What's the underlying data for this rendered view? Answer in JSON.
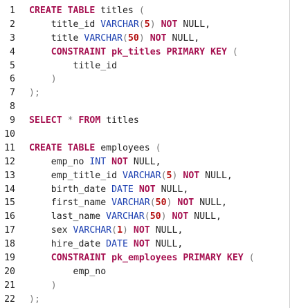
{
  "editor": {
    "colors": {
      "keyword": "#a50f4f",
      "type": "#1a3eb0",
      "number": "#b30c0c",
      "punctuation": "#7a7a7a",
      "identifier": "#1f1f1f",
      "line_number": "#222222"
    },
    "lines": [
      {
        "n": "1",
        "tokens": [
          [
            "kw",
            "CREATE TABLE"
          ],
          [
            "id",
            " titles "
          ],
          [
            "p",
            "("
          ]
        ]
      },
      {
        "n": "2",
        "tokens": [
          [
            "id",
            "    title_id "
          ],
          [
            "ty",
            "VARCHAR"
          ],
          [
            "p",
            "("
          ],
          [
            "num",
            "5"
          ],
          [
            "p",
            ")"
          ],
          [
            "id",
            " "
          ],
          [
            "kw",
            "NOT"
          ],
          [
            "id",
            " NULL,"
          ]
        ]
      },
      {
        "n": "3",
        "tokens": [
          [
            "id",
            "    title "
          ],
          [
            "ty",
            "VARCHAR"
          ],
          [
            "p",
            "("
          ],
          [
            "num",
            "50"
          ],
          [
            "p",
            ")"
          ],
          [
            "id",
            " "
          ],
          [
            "kw",
            "NOT"
          ],
          [
            "id",
            " NULL,"
          ]
        ]
      },
      {
        "n": "4",
        "tokens": [
          [
            "id",
            "    "
          ],
          [
            "kw",
            "CONSTRAINT"
          ],
          [
            "id",
            " "
          ],
          [
            "kw",
            "pk_titles"
          ],
          [
            "id",
            " "
          ],
          [
            "kw",
            "PRIMARY KEY"
          ],
          [
            "id",
            " "
          ],
          [
            "p",
            "("
          ]
        ]
      },
      {
        "n": "5",
        "tokens": [
          [
            "id",
            "        title_id"
          ]
        ]
      },
      {
        "n": "6",
        "tokens": [
          [
            "id",
            "    "
          ],
          [
            "p",
            ")"
          ]
        ]
      },
      {
        "n": "7",
        "tokens": [
          [
            "p",
            ");"
          ]
        ]
      },
      {
        "n": "8",
        "tokens": []
      },
      {
        "n": "9",
        "tokens": [
          [
            "kw",
            "SELECT"
          ],
          [
            "id",
            " "
          ],
          [
            "p",
            "*"
          ],
          [
            "id",
            " "
          ],
          [
            "kw",
            "FROM"
          ],
          [
            "id",
            " titles"
          ]
        ]
      },
      {
        "n": "10",
        "tokens": []
      },
      {
        "n": "11",
        "tokens": [
          [
            "kw",
            "CREATE TABLE"
          ],
          [
            "id",
            " employees "
          ],
          [
            "p",
            "("
          ]
        ]
      },
      {
        "n": "12",
        "tokens": [
          [
            "id",
            "    emp_no "
          ],
          [
            "ty",
            "INT"
          ],
          [
            "id",
            " "
          ],
          [
            "kw",
            "NOT"
          ],
          [
            "id",
            " NULL,"
          ]
        ]
      },
      {
        "n": "13",
        "tokens": [
          [
            "id",
            "    emp_title_id "
          ],
          [
            "ty",
            "VARCHAR"
          ],
          [
            "p",
            "("
          ],
          [
            "num",
            "5"
          ],
          [
            "p",
            ")"
          ],
          [
            "id",
            " "
          ],
          [
            "kw",
            "NOT"
          ],
          [
            "id",
            " NULL,"
          ]
        ]
      },
      {
        "n": "14",
        "tokens": [
          [
            "id",
            "    birth_date "
          ],
          [
            "ty",
            "DATE"
          ],
          [
            "id",
            " "
          ],
          [
            "kw",
            "NOT"
          ],
          [
            "id",
            " NULL,"
          ]
        ]
      },
      {
        "n": "15",
        "tokens": [
          [
            "id",
            "    first_name "
          ],
          [
            "ty",
            "VARCHAR"
          ],
          [
            "p",
            "("
          ],
          [
            "num",
            "50"
          ],
          [
            "p",
            ")"
          ],
          [
            "id",
            " "
          ],
          [
            "kw",
            "NOT"
          ],
          [
            "id",
            " NULL,"
          ]
        ]
      },
      {
        "n": "16",
        "tokens": [
          [
            "id",
            "    last_name "
          ],
          [
            "ty",
            "VARCHAR"
          ],
          [
            "p",
            "("
          ],
          [
            "num",
            "50"
          ],
          [
            "p",
            ")"
          ],
          [
            "id",
            " "
          ],
          [
            "kw",
            "NOT"
          ],
          [
            "id",
            " NULL,"
          ]
        ]
      },
      {
        "n": "17",
        "tokens": [
          [
            "id",
            "    sex "
          ],
          [
            "ty",
            "VARCHAR"
          ],
          [
            "p",
            "("
          ],
          [
            "num",
            "1"
          ],
          [
            "p",
            ")"
          ],
          [
            "id",
            " "
          ],
          [
            "kw",
            "NOT"
          ],
          [
            "id",
            " NULL,"
          ]
        ]
      },
      {
        "n": "18",
        "tokens": [
          [
            "id",
            "    hire_date "
          ],
          [
            "ty",
            "DATE"
          ],
          [
            "id",
            " "
          ],
          [
            "kw",
            "NOT"
          ],
          [
            "id",
            " NULL,"
          ]
        ]
      },
      {
        "n": "19",
        "tokens": [
          [
            "id",
            "    "
          ],
          [
            "kw",
            "CONSTRAINT"
          ],
          [
            "id",
            " "
          ],
          [
            "kw",
            "pk_employees"
          ],
          [
            "id",
            " "
          ],
          [
            "kw",
            "PRIMARY KEY"
          ],
          [
            "id",
            " "
          ],
          [
            "p",
            "("
          ]
        ]
      },
      {
        "n": "20",
        "tokens": [
          [
            "id",
            "        emp_no"
          ]
        ]
      },
      {
        "n": "21",
        "tokens": [
          [
            "id",
            "    "
          ],
          [
            "p",
            ")"
          ]
        ]
      },
      {
        "n": "22",
        "tokens": [
          [
            "p",
            ");"
          ]
        ]
      }
    ]
  }
}
